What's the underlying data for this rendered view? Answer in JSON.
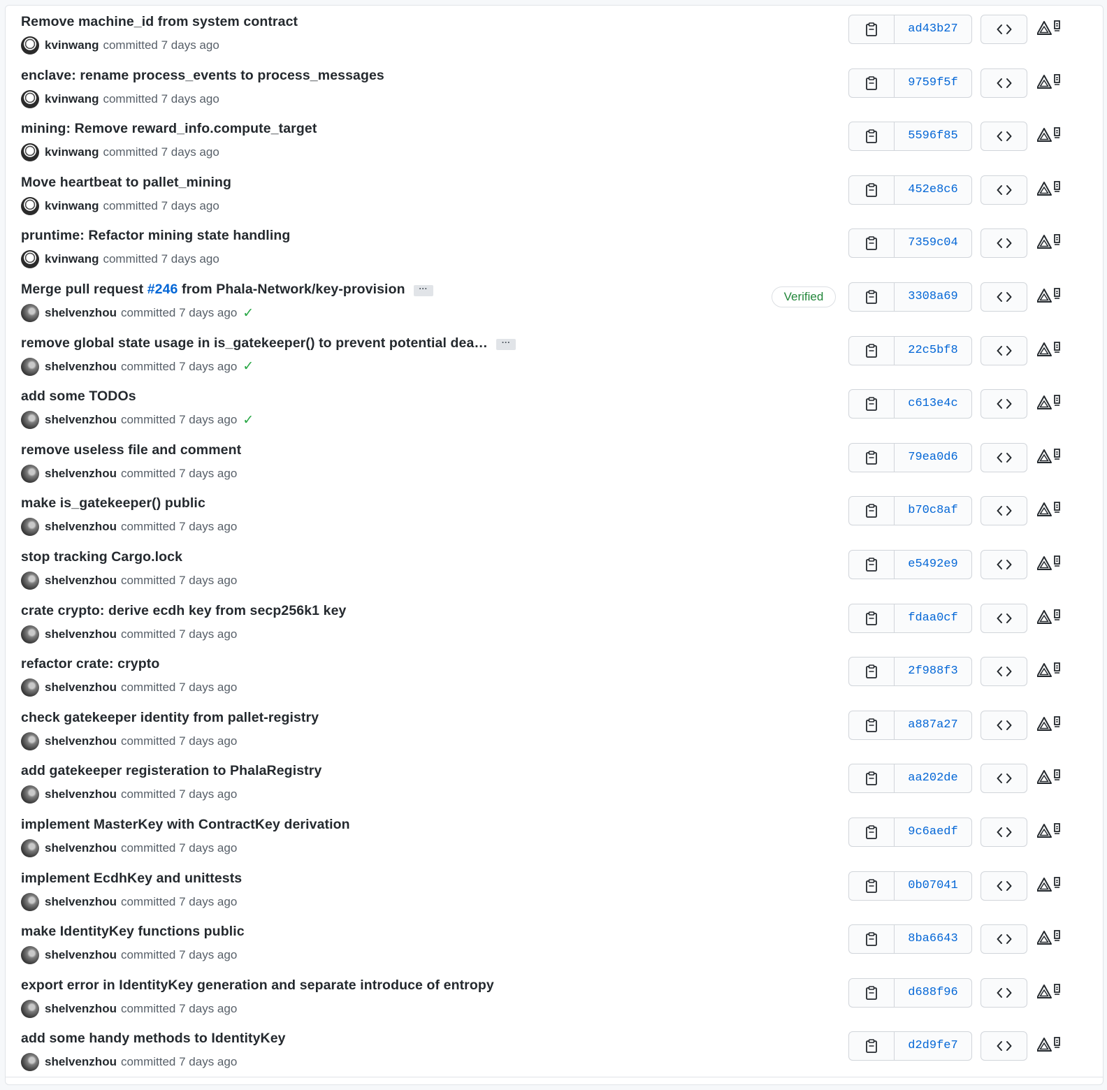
{
  "verified_label": "Verified",
  "committed_text": "committed 7 days ago",
  "commits": [
    {
      "message": "Remove machine_id from system contract",
      "author": "kvinwang",
      "sha": "ad43b27",
      "verified": false,
      "checked": false
    },
    {
      "message": "enclave: rename process_events to process_messages",
      "author": "kvinwang",
      "sha": "9759f5f",
      "verified": false,
      "checked": false
    },
    {
      "message": "mining: Remove reward_info.compute_target",
      "author": "kvinwang",
      "sha": "5596f85",
      "verified": false,
      "checked": false
    },
    {
      "message": "Move heartbeat to pallet_mining",
      "author": "kvinwang",
      "sha": "452e8c6",
      "verified": false,
      "checked": false
    },
    {
      "message": "pruntime: Refactor mining state handling",
      "author": "kvinwang",
      "sha": "7359c04",
      "verified": false,
      "checked": false
    },
    {
      "message_prefix": "Merge pull request ",
      "pr": "#246",
      "message_suffix": " from Phala-Network/key-provision",
      "author": "shelvenzhou",
      "sha": "3308a69",
      "verified": true,
      "checked": true,
      "expandable": true
    },
    {
      "message": "remove global state usage in is_gatekeeper() to prevent potential dea…",
      "author": "shelvenzhou",
      "sha": "22c5bf8",
      "verified": false,
      "checked": true,
      "expandable": true
    },
    {
      "message": "add some TODOs",
      "author": "shelvenzhou",
      "sha": "c613e4c",
      "verified": false,
      "checked": true
    },
    {
      "message": "remove useless file and comment",
      "author": "shelvenzhou",
      "sha": "79ea0d6",
      "verified": false,
      "checked": false
    },
    {
      "message": "make is_gatekeeper() public",
      "author": "shelvenzhou",
      "sha": "b70c8af",
      "verified": false,
      "checked": false
    },
    {
      "message": "stop tracking Cargo.lock",
      "author": "shelvenzhou",
      "sha": "e5492e9",
      "verified": false,
      "checked": false
    },
    {
      "message": "crate crypto: derive ecdh key from secp256k1 key",
      "author": "shelvenzhou",
      "sha": "fdaa0cf",
      "verified": false,
      "checked": false
    },
    {
      "message": "refactor crate: crypto",
      "author": "shelvenzhou",
      "sha": "2f988f3",
      "verified": false,
      "checked": false
    },
    {
      "message": "check gatekeeper identity from pallet-registry",
      "author": "shelvenzhou",
      "sha": "a887a27",
      "verified": false,
      "checked": false
    },
    {
      "message": "add gatekeeper registeration to PhalaRegistry",
      "author": "shelvenzhou",
      "sha": "aa202de",
      "verified": false,
      "checked": false
    },
    {
      "message": "implement MasterKey with ContractKey derivation",
      "author": "shelvenzhou",
      "sha": "9c6aedf",
      "verified": false,
      "checked": false
    },
    {
      "message": "implement EcdhKey and unittests",
      "author": "shelvenzhou",
      "sha": "0b07041",
      "verified": false,
      "checked": false
    },
    {
      "message": "make IdentityKey functions public",
      "author": "shelvenzhou",
      "sha": "8ba6643",
      "verified": false,
      "checked": false
    },
    {
      "message": "export error in IdentityKey generation and separate introduce of entropy",
      "author": "shelvenzhou",
      "sha": "d688f96",
      "verified": false,
      "checked": false
    },
    {
      "message": "add some handy methods to IdentityKey",
      "author": "shelvenzhou",
      "sha": "d2d9fe7",
      "verified": false,
      "checked": false
    }
  ],
  "icons": {
    "avatar": "avatar",
    "checkmark": "check-icon",
    "copy": "clipboard-icon",
    "browse": "code-icon",
    "extension": "extension-icon"
  },
  "colors": {
    "link": "#0366d6",
    "verified": "#22863a",
    "check": "#28a745",
    "border": "#e1e4e8"
  }
}
